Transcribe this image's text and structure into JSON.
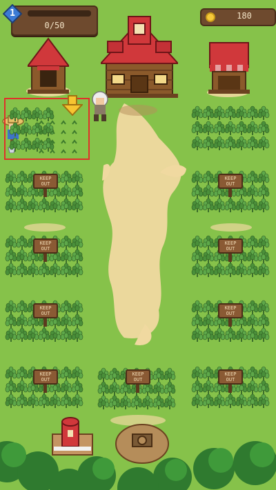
{
  "hud": {
    "level": "1",
    "xp_text": "0/50",
    "xp_fraction": 0,
    "coins": "180"
  },
  "signs": {
    "keep_out_line1": "KEEP",
    "keep_out_line2": "OUT"
  },
  "colors": {
    "grass": "#86c24a",
    "path": "#f0d9a0",
    "selection": "#e0302a",
    "hud_panel": "#6e4a2e"
  }
}
